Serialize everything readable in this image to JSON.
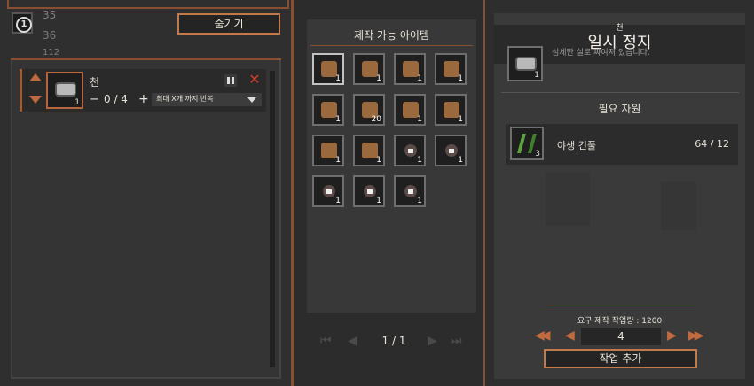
{
  "left_panel": {
    "hide_button": "숨기기",
    "bg_numbers": [
      "35",
      "36",
      "112"
    ],
    "queue_item": {
      "name": "천",
      "count": "1",
      "progress": "0 / 4",
      "minus": "−",
      "plus": "+",
      "repeat_option": "최대 X개 까지 반복"
    }
  },
  "middle_panel": {
    "title": "제작 가능 아이템",
    "pager": "1 / 1",
    "items": [
      {
        "icon": "cloth-roll-icon",
        "count": "1",
        "locked": false
      },
      {
        "icon": "herb-bundle-icon",
        "count": "1",
        "locked": false
      },
      {
        "icon": "wooden-stick-icon",
        "count": "1",
        "locked": false
      },
      {
        "icon": "wooden-club-icon",
        "count": "1",
        "locked": false
      },
      {
        "icon": "bow-icon",
        "count": "1",
        "locked": false
      },
      {
        "icon": "arrow-icon",
        "count": "20",
        "locked": false
      },
      {
        "icon": "cloth-armor-icon",
        "count": "1",
        "locked": false
      },
      {
        "icon": "shirt-icon",
        "count": "1",
        "locked": false
      },
      {
        "icon": "torch-icon",
        "count": "1",
        "locked": false
      },
      {
        "icon": "rope-icon",
        "count": "1",
        "locked": false
      },
      {
        "icon": "lock-icon",
        "count": "1",
        "locked": true
      },
      {
        "icon": "lock-icon",
        "count": "1",
        "locked": true
      },
      {
        "icon": "lock-icon",
        "count": "1",
        "locked": true
      },
      {
        "icon": "lock-icon",
        "count": "1",
        "locked": true
      },
      {
        "icon": "lock-icon",
        "count": "1",
        "locked": true
      }
    ]
  },
  "right_panel": {
    "item_name": "천",
    "item_count": "1",
    "description": "섬세한 실로 짜여져 있습니다.",
    "pause_overlay": "일시 정지",
    "required_resources_title": "필요 자원",
    "resource": {
      "name": "야생 긴풀",
      "count": "3",
      "amount": "64 / 12"
    },
    "required_work": "요구 제작 작업량 : 1200",
    "quantity": "4",
    "add_job_button": "작업 추가"
  },
  "colors": {
    "accent": "#b5663e",
    "panel": "#353535",
    "slot_bg": "#1f1f1f",
    "close_red": "#d23a2a"
  }
}
